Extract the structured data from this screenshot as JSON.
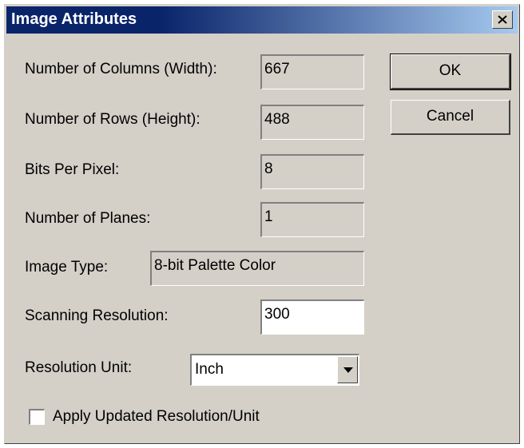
{
  "window": {
    "title": "Image Attributes",
    "close_icon": "close-x-icon"
  },
  "fields": {
    "columns": {
      "label": "Number of Columns (Width):",
      "value": "667"
    },
    "rows": {
      "label": "Number of Rows (Height):",
      "value": "488"
    },
    "bits": {
      "label": "Bits Per Pixel:",
      "value": "8"
    },
    "planes": {
      "label": "Number of Planes:",
      "value": "1"
    },
    "image_type": {
      "label": "Image Type:",
      "value": "8-bit Palette Color"
    },
    "scanning_resolution": {
      "label": "Scanning Resolution:",
      "value": "300"
    },
    "resolution_unit": {
      "label": "Resolution Unit:",
      "value": "Inch"
    }
  },
  "buttons": {
    "ok": "OK",
    "cancel": "Cancel"
  },
  "checkbox": {
    "label": "Apply Updated Resolution/Unit",
    "checked": false
  },
  "colors": {
    "title_bar": "#0a246a",
    "dialog_bg": "#d4d0c8"
  }
}
